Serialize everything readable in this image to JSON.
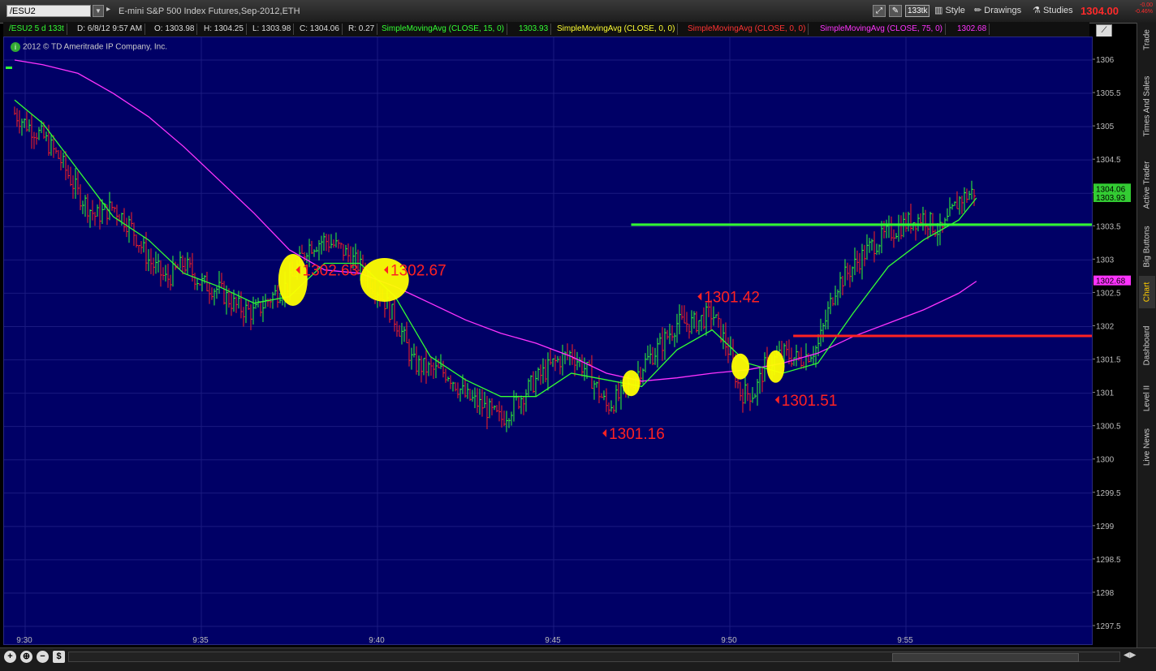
{
  "toolbar": {
    "symbol": "/ESU2",
    "description": "E-mini S&P 500 Index Futures,Sep-2012,ETH",
    "tick_badge": "133tk",
    "style_label": "Style",
    "drawings_label": "Drawings",
    "studies_label": "Studies",
    "last_price": "1304.00",
    "change": "-0.00",
    "change_pct": "-0.46%"
  },
  "infobar": {
    "symbol": "/ESU2 5 d 133t",
    "date": "D: 6/8/12 9:57 AM",
    "open": "O: 1303.98",
    "high": "H: 1304.25",
    "low": "L: 1303.98",
    "close": "C: 1304.06",
    "range": "R: 0.27",
    "sma15_label": "SimpleMovingAvg (CLOSE, 15, 0)",
    "sma15_value": "1303.93",
    "sma0y_label": "SimpleMovingAvg (CLOSE, 0, 0)",
    "sma0r_label": "SimpleMovingAvg (CLOSE, 0, 0)",
    "sma75_label": "SimpleMovingAvg (CLOSE, 75, 0)",
    "sma75_value": "1302.68"
  },
  "copyright": "2012 © TD Ameritrade IP Company, Inc.",
  "sidebar": [
    "Trade",
    "Times And Sales",
    "Active Trader",
    "Big Buttons",
    "Chart",
    "Dashboard",
    "Level II",
    "Live News"
  ],
  "colors": {
    "green": "#33ff33",
    "magenta": "#ff33ff",
    "red": "#ff2222",
    "yellow": "#ffff00",
    "chart_bg": "#000066"
  },
  "chart_data": {
    "type": "line",
    "x_ticks": [
      "9:30",
      "9:35",
      "9:40",
      "9:45",
      "9:50",
      "9:55"
    ],
    "y_ticks": [
      "1306",
      "1305.5",
      "1305",
      "1304.5",
      "1304",
      "1303.5",
      "1303",
      "1302.5",
      "1302",
      "1301.5",
      "1301",
      "1300.5",
      "1300",
      "1299.5",
      "1299",
      "1298.5",
      "1298",
      "1297.5"
    ],
    "ylim": [
      1297.5,
      1306.0
    ],
    "price_tags": [
      "1304.06",
      "1303.93",
      "1302.68"
    ],
    "annotations": [
      {
        "text": "1302.63",
        "time": "9:37.8",
        "price": 1302.85
      },
      {
        "text": "1302.67",
        "time": "9:40.3",
        "price": 1302.85
      },
      {
        "text": "1301.42",
        "time": "9:49.2",
        "price": 1302.45
      },
      {
        "text": "1301.16",
        "time": "9:46.5",
        "price": 1300.4
      },
      {
        "text": "1301.51",
        "time": "9:51.4",
        "price": 1300.9
      }
    ],
    "horizontal_lines": [
      {
        "price": 1303.53,
        "from": "9:47.2",
        "color": "green"
      },
      {
        "price": 1301.86,
        "from": "9:51.8",
        "color": "red"
      }
    ],
    "highlights": [
      {
        "time": "9:37.6",
        "price": 1302.7
      },
      {
        "time": "9:40.2",
        "price": 1302.7
      },
      {
        "time": "9:47.2",
        "price": 1301.15
      },
      {
        "time": "9:50.3",
        "price": 1301.4
      },
      {
        "time": "9:51.3",
        "price": 1301.4
      }
    ],
    "close_series": [
      [
        "9:29.7",
        1305.2
      ],
      [
        "9:30",
        1305.05
      ],
      [
        "9:30.5",
        1304.85
      ],
      [
        "9:31",
        1304.5
      ],
      [
        "9:31.5",
        1304.0
      ],
      [
        "9:32",
        1303.65
      ],
      [
        "9:32.5",
        1303.8
      ],
      [
        "9:33",
        1303.5
      ],
      [
        "9:33.5",
        1303.0
      ],
      [
        "9:34",
        1302.7
      ],
      [
        "9:34.5",
        1302.95
      ],
      [
        "9:35",
        1302.65
      ],
      [
        "9:35.5",
        1302.55
      ],
      [
        "9:36",
        1302.3
      ],
      [
        "9:36.5",
        1302.2
      ],
      [
        "9:37",
        1302.45
      ],
      [
        "9:37.5",
        1302.65
      ],
      [
        "9:38",
        1303.2
      ],
      [
        "9:38.5",
        1303.3
      ],
      [
        "9:39",
        1303.15
      ],
      [
        "9:39.5",
        1302.9
      ],
      [
        "9:40",
        1302.55
      ],
      [
        "9:40.3",
        1302.3
      ],
      [
        "9:40.7",
        1301.9
      ],
      [
        "9:41",
        1301.45
      ],
      [
        "9:41.5",
        1301.35
      ],
      [
        "9:42",
        1301.3
      ],
      [
        "9:42.5",
        1300.95
      ],
      [
        "9:43",
        1300.8
      ],
      [
        "9:43.5",
        1300.6
      ],
      [
        "9:44",
        1300.9
      ],
      [
        "9:44.5",
        1301.2
      ],
      [
        "9:45",
        1301.45
      ],
      [
        "9:45.5",
        1301.6
      ],
      [
        "9:46",
        1301.3
      ],
      [
        "9:46.5",
        1300.8
      ],
      [
        "9:47",
        1301.0
      ],
      [
        "9:47.5",
        1301.4
      ],
      [
        "9:48",
        1301.7
      ],
      [
        "9:48.5",
        1302.05
      ],
      [
        "9:49",
        1302.05
      ],
      [
        "9:49.5",
        1302.2
      ],
      [
        "9:50",
        1301.6
      ],
      [
        "9:50.3",
        1301.0
      ],
      [
        "9:50.7",
        1301.0
      ],
      [
        "9:51",
        1301.4
      ],
      [
        "9:51.5",
        1301.6
      ],
      [
        "9:52",
        1301.5
      ],
      [
        "9:52.5",
        1301.7
      ],
      [
        "9:53",
        1302.6
      ],
      [
        "9:53.5",
        1302.9
      ],
      [
        "9:54",
        1303.2
      ],
      [
        "9:54.5",
        1303.4
      ],
      [
        "9:55",
        1303.55
      ],
      [
        "9:55.5",
        1303.65
      ],
      [
        "9:56",
        1303.4
      ],
      [
        "9:56.5",
        1303.9
      ],
      [
        "9:57",
        1304.05
      ]
    ],
    "sma15_series": [
      [
        "9:29.7",
        1305.4
      ],
      [
        "9:30.5",
        1305.05
      ],
      [
        "9:31.5",
        1304.35
      ],
      [
        "9:32.5",
        1303.65
      ],
      [
        "9:33.5",
        1303.3
      ],
      [
        "9:34.5",
        1302.8
      ],
      [
        "9:35.5",
        1302.6
      ],
      [
        "9:36.5",
        1302.35
      ],
      [
        "9:37.5",
        1302.45
      ],
      [
        "9:38.5",
        1302.95
      ],
      [
        "9:39.5",
        1302.95
      ],
      [
        "9:40.5",
        1302.45
      ],
      [
        "9:41.5",
        1301.55
      ],
      [
        "9:42.5",
        1301.2
      ],
      [
        "9:43.5",
        1300.95
      ],
      [
        "9:44.5",
        1300.95
      ],
      [
        "9:45.5",
        1301.3
      ],
      [
        "9:46.5",
        1301.2
      ],
      [
        "9:47.5",
        1301.1
      ],
      [
        "9:48.5",
        1301.65
      ],
      [
        "9:49.5",
        1301.95
      ],
      [
        "9:50.5",
        1301.45
      ],
      [
        "9:51.5",
        1301.3
      ],
      [
        "9:52.5",
        1301.45
      ],
      [
        "9:53.5",
        1302.2
      ],
      [
        "9:54.5",
        1302.9
      ],
      [
        "9:55.5",
        1303.3
      ],
      [
        "9:56.5",
        1303.6
      ],
      [
        "9:57",
        1303.93
      ]
    ],
    "sma75_series": [
      [
        "9:29.7",
        1306.0
      ],
      [
        "9:30.5",
        1305.93
      ],
      [
        "9:31.5",
        1305.8
      ],
      [
        "9:32.5",
        1305.5
      ],
      [
        "9:33.5",
        1305.15
      ],
      [
        "9:34.5",
        1304.7
      ],
      [
        "9:35.5",
        1304.2
      ],
      [
        "9:36.5",
        1303.7
      ],
      [
        "9:37.5",
        1303.15
      ],
      [
        "9:38.5",
        1302.85
      ],
      [
        "9:39.5",
        1302.8
      ],
      [
        "9:40.5",
        1302.6
      ],
      [
        "9:41.5",
        1302.35
      ],
      [
        "9:42.5",
        1302.1
      ],
      [
        "9:43.5",
        1301.9
      ],
      [
        "9:44.5",
        1301.75
      ],
      [
        "9:45.5",
        1301.55
      ],
      [
        "9:46.5",
        1301.3
      ],
      [
        "9:47.5",
        1301.18
      ],
      [
        "9:48.5",
        1301.23
      ],
      [
        "9:49.5",
        1301.3
      ],
      [
        "9:50.5",
        1301.35
      ],
      [
        "9:51.5",
        1301.45
      ],
      [
        "9:52.5",
        1301.6
      ],
      [
        "9:53.5",
        1301.85
      ],
      [
        "9:54.5",
        1302.05
      ],
      [
        "9:55.5",
        1302.25
      ],
      [
        "9:56.5",
        1302.5
      ],
      [
        "9:57",
        1302.68
      ]
    ]
  }
}
